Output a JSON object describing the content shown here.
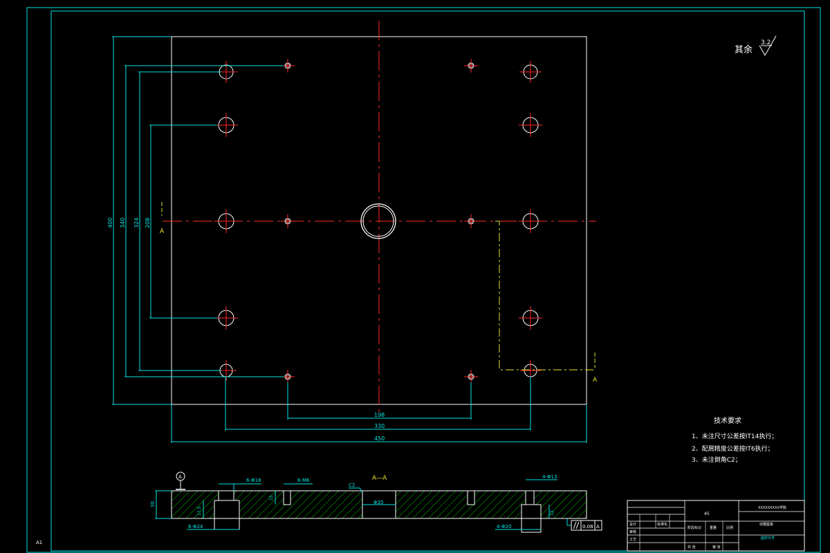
{
  "colors": {
    "background": "#000000",
    "frame": "#00e5e5",
    "outline": "#ffffff",
    "centerline": "#ff2a2a",
    "section_line": "#e5e533",
    "hatch": "#00c000"
  },
  "drawing": {
    "sheet_label": "A1",
    "roughness_note": "其余",
    "roughness_value": "3.2",
    "section_mark": "A",
    "section_title": "A—A",
    "datum_label": "A",
    "tolerance_value": "0.08",
    "tolerance_datum": "A"
  },
  "dimensions": {
    "height_400": "400",
    "height_340": "340",
    "height_324": "324",
    "height_208": "208",
    "width_198": "198",
    "width_330": "330",
    "width_450": "450",
    "thickness_30": "30",
    "depth_17_5": "17.5",
    "depth_15": "15",
    "depth_12": "12",
    "callout_holes_18": "6-Φ18",
    "callout_holes_m6": "6-M6",
    "callout_holes_24": "6-Φ24",
    "callout_chamfer": "C2",
    "callout_bore_35": "Φ35",
    "callout_holes_13": "4-Φ13",
    "callout_holes_20": "4-Φ20"
  },
  "tech_requirements": {
    "title": "技术要求",
    "items": [
      "1、未注尺寸公差按IT14执行；",
      "2、配屑精度公差按IT6执行；",
      "3、未注倒角C2；"
    ]
  },
  "title_block": {
    "material": "45",
    "title_cell": "XXXXXXXXX学院",
    "part_name": "动模座板",
    "drawing_no": "图样代号",
    "stage_label": "阶段标记",
    "weight_label": "重量",
    "scale_label": "比例",
    "design_label": "设计",
    "std_label": "标准化",
    "audit_label": "审核",
    "process_label": "工艺",
    "sheet_label": "共 张",
    "page_label": "第 张"
  }
}
